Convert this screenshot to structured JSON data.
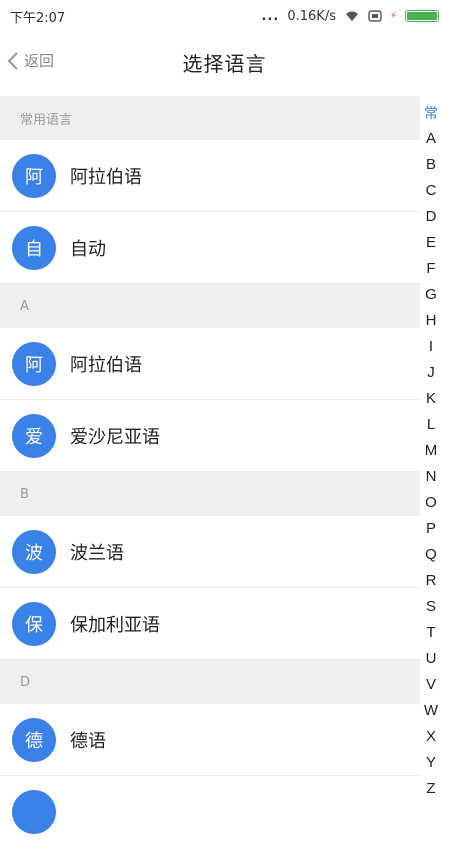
{
  "status_bar": {
    "time": "下午2:07",
    "network_speed": "0.16K/s",
    "signal_dots": "...",
    "wifi_icon": "wifi-icon",
    "battery_icon": "battery-icon",
    "battery_level": 1.0,
    "accent_green": "#4caf50"
  },
  "nav": {
    "back_label": "返回",
    "title": "选择语言"
  },
  "sections": [
    {
      "header": "常用语言",
      "items": [
        {
          "badge": "阿",
          "label": "阿拉伯语"
        },
        {
          "badge": "自",
          "label": "自动"
        }
      ]
    },
    {
      "header": "A",
      "items": [
        {
          "badge": "阿",
          "label": "阿拉伯语"
        },
        {
          "badge": "爱",
          "label": "爱沙尼亚语"
        }
      ]
    },
    {
      "header": "B",
      "items": [
        {
          "badge": "波",
          "label": "波兰语"
        },
        {
          "badge": "保",
          "label": "保加利亚语"
        }
      ]
    },
    {
      "header": "D",
      "items": [
        {
          "badge": "德",
          "label": "德语"
        },
        {
          "badge": "",
          "label": ""
        }
      ]
    }
  ],
  "index_bar": [
    "常",
    "A",
    "B",
    "C",
    "D",
    "E",
    "F",
    "G",
    "H",
    "I",
    "J",
    "K",
    "L",
    "M",
    "N",
    "O",
    "P",
    "Q",
    "R",
    "S",
    "T",
    "U",
    "V",
    "W",
    "X",
    "Y",
    "Z"
  ],
  "colors": {
    "accent": "#3b82e8",
    "section_bg": "#efefef"
  }
}
